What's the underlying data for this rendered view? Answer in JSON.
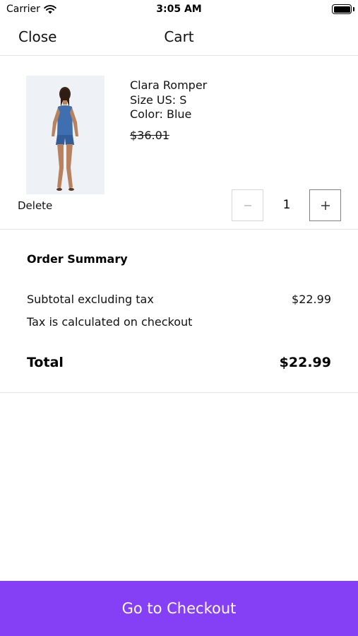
{
  "status_bar": {
    "carrier": "Carrier",
    "time": "3:05 AM",
    "wifi_icon": "wifi-icon",
    "battery_icon": "battery-icon"
  },
  "nav": {
    "close_label": "Close",
    "title": "Cart"
  },
  "cart": {
    "items": [
      {
        "name": "Clara Romper",
        "size": "Size US: S",
        "color": "Color: Blue",
        "price": "$36.01",
        "delete_label": "Delete",
        "quantity": "1",
        "minus_icon": "minus-icon",
        "plus_icon": "plus-icon"
      }
    ]
  },
  "summary": {
    "heading": "Order Summary",
    "subtotal_label": "Subtotal excluding tax",
    "subtotal_value": "$22.99",
    "tax_note": "Tax is calculated on checkout",
    "total_label": "Total",
    "total_value": "$22.99"
  },
  "checkout": {
    "label": "Go to Checkout"
  },
  "colors": {
    "accent": "#8540f5",
    "divider": "#e6e6e6"
  }
}
